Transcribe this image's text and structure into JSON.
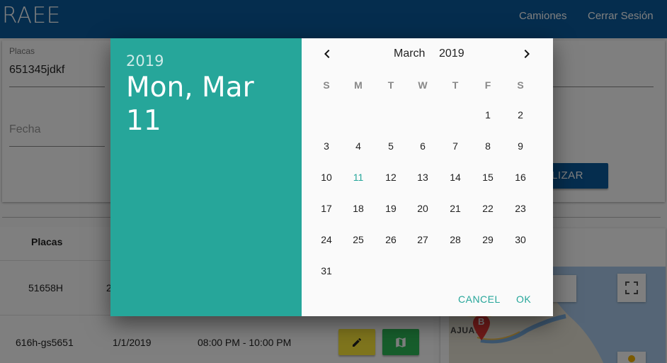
{
  "header": {
    "brand": "RAEE",
    "nav": [
      "Camiones",
      "Cerrar Sesión"
    ]
  },
  "form": {
    "placas_label": "Placas",
    "placas_value": "651345jdkf",
    "fecha_placeholder": "Fecha",
    "update_button": "LIZAR"
  },
  "table": {
    "header_placas": "Placas",
    "rows": [
      {
        "placas": "51658H",
        "fecha": "2"
      },
      {
        "placas": "616h-gs5651",
        "fecha": "1/1/2019",
        "horario": "08:00 PM - 10:00 PM"
      }
    ]
  },
  "map": {
    "partial_control": "te",
    "town": "AJUATO",
    "marker": "B"
  },
  "datepicker": {
    "year": "2019",
    "selected_date": "Mon, Mar 11",
    "month": "March",
    "cal_year": "2019",
    "weekdays": [
      "S",
      "M",
      "T",
      "W",
      "T",
      "F",
      "S"
    ],
    "first_weekday": 5,
    "days_in_month": 31,
    "selected_day": 11,
    "cancel": "CANCEL",
    "ok": "OK"
  },
  "colors": {
    "primary": "#0a5a9c",
    "accent": "#26a69a",
    "edit": "#ffeb3b",
    "map_button": "#2ebd59"
  }
}
